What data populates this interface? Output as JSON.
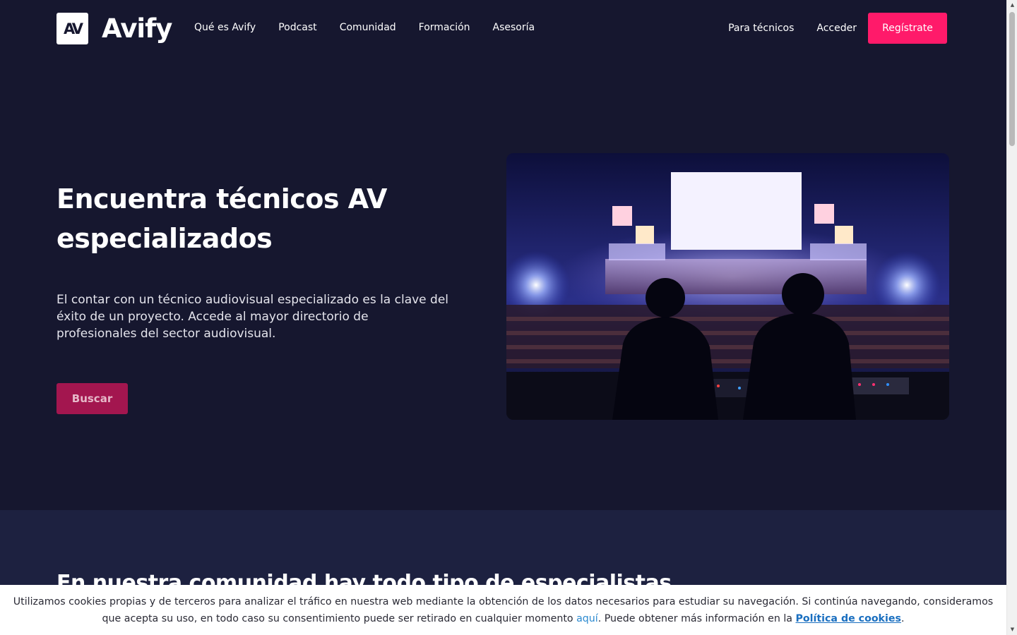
{
  "nav": {
    "logo_mark": "AV",
    "logo_word": "Avify",
    "links": [
      "Qué es Avify",
      "Podcast",
      "Comunidad",
      "Formación",
      "Asesoría"
    ],
    "tech_link": "Para técnicos",
    "login_link": "Acceder",
    "register_button": "Regístrate"
  },
  "hero": {
    "title": "Encuentra técnicos AV especializados",
    "description": "El contar con un técnico audiovisual especializado es la clave del éxito de un proyecto. Accede al mayor directorio de profesionales del sector audiovisual.",
    "search_button": "Buscar",
    "image_icon": "concert-sound-engineers-photo"
  },
  "section2": {
    "title": "En nuestra comunidad hay todo tipo de especialistas"
  },
  "cookie": {
    "text_before": "Utilizamos cookies propias y de terceros para analizar el tráfico en nuestra web mediante la obtención de los datos necesarios para estudiar su navegación. Si continúa navegando, consideramos que acepta su uso, en todo caso su consentimiento puede ser retirado en cualquier momento",
    "link_here": "aquí",
    "text_middle": ". Puede obtener más información en la",
    "link_policy": "Política de cookies",
    "text_after": "."
  },
  "colors": {
    "background": "#16172f",
    "section2_background": "#1d2140",
    "accent": "#ff1a6a",
    "search_button": "#a3164f"
  }
}
